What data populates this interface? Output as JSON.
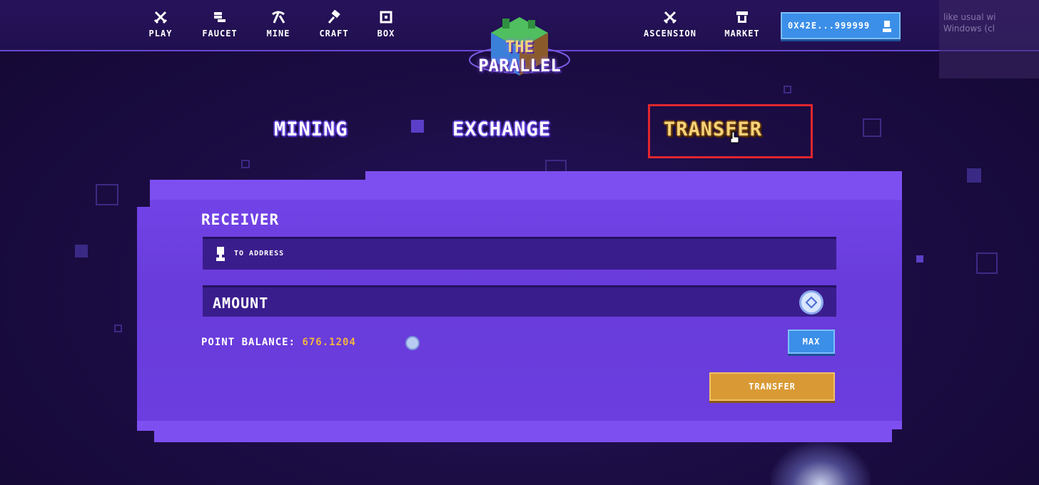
{
  "nav": {
    "left_items": [
      {
        "label": "PLAY",
        "icon": "swords-icon"
      },
      {
        "label": "FAUCET",
        "icon": "coins-icon"
      },
      {
        "label": "MINE",
        "icon": "pickaxe-icon"
      },
      {
        "label": "CRAFT",
        "icon": "hammer-icon"
      },
      {
        "label": "BOX",
        "icon": "box-icon"
      }
    ],
    "right_items": [
      {
        "label": "ASCENSION",
        "icon": "swords-icon"
      },
      {
        "label": "MARKET",
        "icon": "shop-icon"
      }
    ],
    "wallet_label": "0X42E...999999"
  },
  "logo": {
    "line1": "THE",
    "line2": "PARALLEL"
  },
  "toast_text": "like usual wi\nWindows (cl",
  "tabs": [
    {
      "label": "MINING",
      "active": false
    },
    {
      "label": "EXCHANGE",
      "active": false
    },
    {
      "label": "TRANSFER",
      "active": true
    }
  ],
  "form": {
    "receiver_title": "RECEIVER",
    "address_placeholder": "TO ADDRESS",
    "amount_placeholder": "AMOUNT",
    "balance_label": "POINT BALANCE:",
    "balance_value": "676.1204",
    "max_label": "MAX",
    "submit_label": "TRANSFER"
  },
  "colors": {
    "accent_blue": "#3b8fe8",
    "accent_gold": "#d99a35",
    "panel_purple": "#7e4ff0",
    "highlight_red": "#e0262e"
  }
}
